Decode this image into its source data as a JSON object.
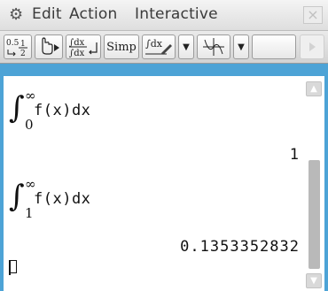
{
  "menubar": {
    "items": [
      "Edit",
      "Action",
      "Interactive"
    ],
    "close_label": "×"
  },
  "toolbar": {
    "fraction_top": "0.5",
    "fraction_right": "1",
    "fraction_bottom": "2",
    "int_top": "∫dx",
    "int_bottom": "∫dx",
    "simp_label": "Simp",
    "int_dx_label": "∫dx",
    "dropdown_glyph": "▼"
  },
  "entries": [
    {
      "lower": "0",
      "upper": "∞",
      "integrand": "f(x)dx",
      "result": "1"
    },
    {
      "lower": "1",
      "upper": "∞",
      "integrand": "f(x)dx",
      "result": "0.1353352832"
    }
  ],
  "scrollbar": {
    "up_glyph": "▲",
    "down_glyph": "▼"
  }
}
